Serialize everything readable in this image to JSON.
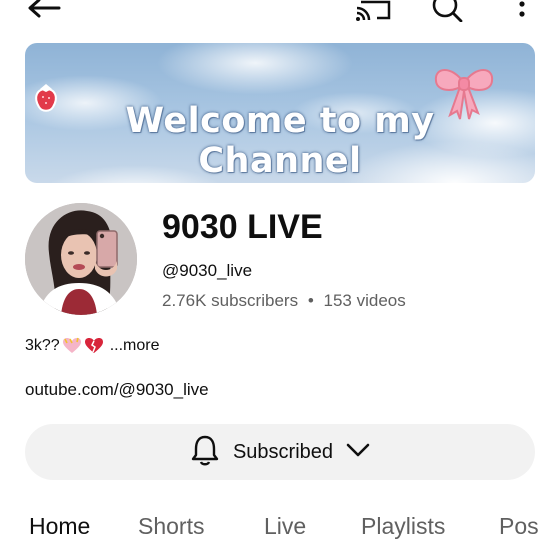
{
  "topbar": {
    "back_icon": "arrow-left-icon",
    "cast_icon": "cast-icon",
    "search_icon": "search-icon",
    "menu_icon": "more-vertical-icon"
  },
  "banner": {
    "text": "Welcome to my Channel"
  },
  "channel": {
    "name": "9030 LIVE",
    "handle": "@9030_live",
    "subscribers": "2.76K subscribers",
    "separator": "•",
    "videos": "153 videos",
    "description": "3k??",
    "more": "...more",
    "link": "outube.com/@9030_live"
  },
  "subscribe": {
    "label": "Subscribed",
    "bell_icon": "bell-icon",
    "chevron_icon": "chevron-down-icon"
  },
  "tabs": [
    {
      "label": "Home",
      "active": true
    },
    {
      "label": "Shorts",
      "active": false
    },
    {
      "label": "Live",
      "active": false
    },
    {
      "label": "Playlists",
      "active": false
    },
    {
      "label": "Pos",
      "active": false
    }
  ],
  "colors": {
    "text_primary": "#0f0f0f",
    "text_secondary": "#606060",
    "button_bg": "#f2f2f2"
  }
}
